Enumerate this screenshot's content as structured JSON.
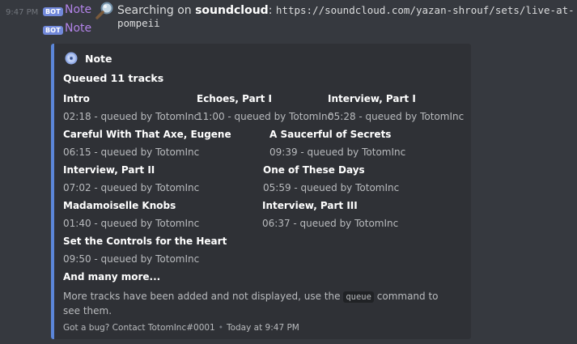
{
  "message1": {
    "timestamp": "9:47 PM",
    "badge": "BOT",
    "username": "Note",
    "icon": "magnifier-icon",
    "text_prefix": "Searching on",
    "source": "soundcloud",
    "colon": ":",
    "url": "https://soundcloud.com/yazan-shrouf/sets/live-at-pompeii"
  },
  "message2": {
    "badge": "BOT",
    "username": "Note"
  },
  "embed": {
    "accent_color": "#5b86d9",
    "author_icon": "disc-icon",
    "author": "Note",
    "title": "Queued 11 tracks",
    "fields": [
      {
        "name": "Intro",
        "value": "02:18 - queued by TotomInc"
      },
      {
        "name": "Echoes, Part I",
        "value": "11:00 - queued by TotomInc"
      },
      {
        "name": "Interview, Part I",
        "value": "05:28 - queued by TotomInc"
      },
      {
        "name": "Careful With That Axe, Eugene",
        "value": "06:15 - queued by TotomInc"
      },
      {
        "name": "A Saucerful of Secrets",
        "value": "09:39 - queued by TotomInc"
      },
      {
        "name": "Interview, Part II",
        "value": "07:02 - queued by TotomInc"
      },
      {
        "name": "One of These Days",
        "value": "05:59 - queued by TotomInc"
      },
      {
        "name": "Madamoiselle Knobs",
        "value": "01:40 - queued by TotomInc"
      },
      {
        "name": "Interview, Part III",
        "value": "06:37 - queued by TotomInc"
      },
      {
        "name": "Set the Controls for the Heart",
        "value": "09:50 - queued by TotomInc"
      }
    ],
    "more_title": "And many more...",
    "more_text_before": "More tracks have been added and not displayed, use the",
    "more_code": "queue",
    "more_text_after": "command to see them.",
    "footer_text": "Got a bug? Contact TotomInc#0001",
    "footer_separator": "•",
    "footer_time": "Today at 9:47 PM"
  }
}
